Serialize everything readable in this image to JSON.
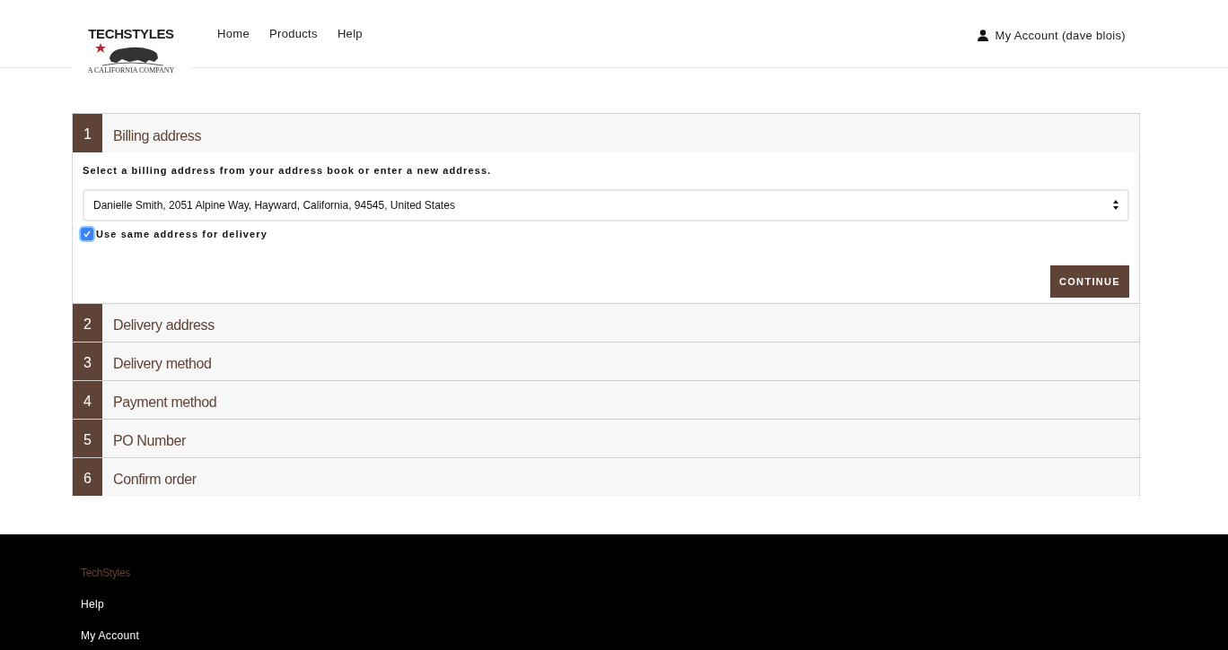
{
  "logo": {
    "name": "TECHSTYLES",
    "tagline": "A CALIFORNIA COMPANY"
  },
  "nav": [
    "Home",
    "Products",
    "Help"
  ],
  "account": "My Account (dave blois)",
  "steps": [
    {
      "number": "1",
      "title": "Billing address",
      "expanded": true
    },
    {
      "number": "2",
      "title": "Delivery address",
      "expanded": false
    },
    {
      "number": "3",
      "title": "Delivery method",
      "expanded": false
    },
    {
      "number": "4",
      "title": "Payment method",
      "expanded": false
    },
    {
      "number": "5",
      "title": "PO Number",
      "expanded": false
    },
    {
      "number": "6",
      "title": "Confirm order",
      "expanded": false
    }
  ],
  "billing": {
    "instruction": "Select a billing address from your address book or enter a new address.",
    "address": "Danielle Smith, 2051 Alpine Way, Hayward, California, 94545, United States",
    "same_address": {
      "label": "Use same address for delivery",
      "checked": true
    },
    "button": "CONTINUE"
  },
  "footer": {
    "brand": "TechStyles",
    "links": [
      "Help",
      "My Account"
    ]
  }
}
